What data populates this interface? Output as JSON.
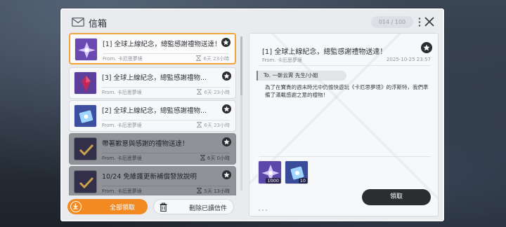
{
  "header": {
    "title": "信箱",
    "counter": "014 / 100"
  },
  "mail_list": [
    {
      "title": "[1] 全球上線紀念，總監感謝禮物送達！",
      "from": "From. 卡厄思夢境",
      "expiry": "6天 23小時",
      "state": "selected"
    },
    {
      "title": "[3] 全球上線紀念，總監感謝禮物...",
      "from": "From. 卡厄思夢境",
      "expiry": "6天 23小時",
      "state": "unread"
    },
    {
      "title": "[2] 全球上線紀念，總監感謝禮物...",
      "from": "From. 卡厄思夢境",
      "expiry": "6天 23小時",
      "state": "unread"
    },
    {
      "title": "帶著歉意與感謝的禮物送達！",
      "from": "From. 卡厄思夢境",
      "expiry": "6天 0小時",
      "state": "read"
    },
    {
      "title": "10/24 免維護更新補償發放說明",
      "from": "From. 卡厄思夢境",
      "expiry": "5天 13小時",
      "state": "read"
    }
  ],
  "buttons": {
    "claim_all": "全部領取",
    "delete_read": "刪除已讀信件",
    "claim": "領取"
  },
  "detail": {
    "title": "[1] 全球上線紀念，總監感謝禮物送達！",
    "from": "From. 卡厄思夢境",
    "date": "2025-10-25 23:57",
    "recipient": "To. 一斬云霄 先生/小姐",
    "body": "為了在寶貴的週末時光中仍愉快遊玩《卡厄思夢境》的浮斯特，我們準備了滿載感謝之意的禮物！",
    "rewards": [
      {
        "icon": "crystal-item-icon",
        "quantity": "1000"
      },
      {
        "icon": "ticket-item-icon",
        "quantity": "10"
      }
    ]
  },
  "colors": {
    "accent": "#f28a21",
    "selected_border": "#f0a43a",
    "dark_button": "#2b2d31"
  }
}
